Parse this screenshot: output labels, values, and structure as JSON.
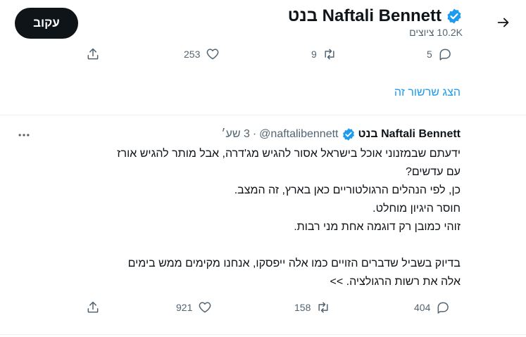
{
  "header": {
    "name": "Naftali Bennett בנט",
    "tweet_count": "10.2K ציוצים",
    "follow_label": "עקוב"
  },
  "top_actions": {
    "replies": "5",
    "retweets": "9",
    "likes": "253"
  },
  "show_thread_label": "הצג שרשור זה",
  "tweet": {
    "name": "Naftali Bennett בנט",
    "handle": "@naftalibennett",
    "dot": "·",
    "time": "3 שע׳",
    "lines": [
      "ידעתם שבמזנוני אוכל בישראל אסור להגיש מג'דרה, אבל מותר להגיש אורז",
      "עם עדשים?",
      "כן, לפי הנהלים הרגולטוריים כאן בארץ, זה המצב.",
      "חוסר היגיון מוחלט.",
      "זוהי כמובן רק דוגמה אחת מני רבות.",
      "",
      "בדיוק בשביל שדברים הזויים כמו אלה ייפסקו, אנחנו מקימים ממש בימים",
      "אלה את רשות הרגולציה. >>"
    ],
    "actions": {
      "replies": "404",
      "retweets": "158",
      "likes": "921"
    }
  },
  "colors": {
    "accent": "#1d9bf0",
    "verified": "#1d9bf0",
    "muted": "#536471",
    "text": "#0f1419",
    "follow_bg": "#0f1419"
  }
}
